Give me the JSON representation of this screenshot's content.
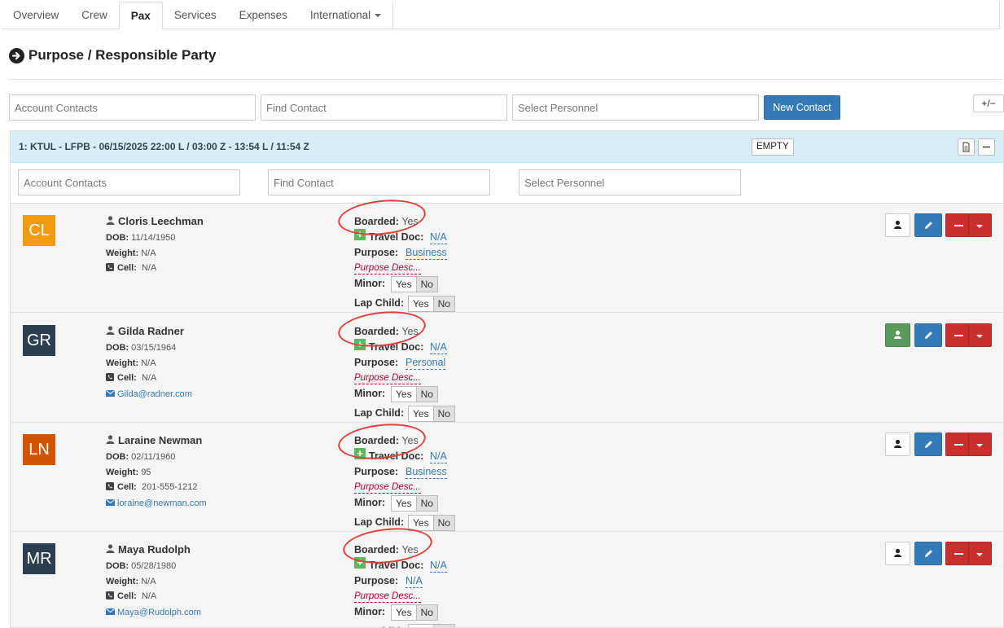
{
  "tabs": [
    {
      "label": "Overview"
    },
    {
      "label": "Crew"
    },
    {
      "label": "Pax"
    },
    {
      "label": "Services"
    },
    {
      "label": "Expenses"
    },
    {
      "label": "International"
    }
  ],
  "page_title": "Purpose / Responsible Party",
  "top_inputs": {
    "account_contacts_placeholder": "Account Contacts",
    "find_contact_placeholder": "Find Contact",
    "select_personnel_placeholder": "Select Personnel",
    "new_contact_label": "New Contact",
    "plus_minus_label": "+/−"
  },
  "leg": {
    "title": "1: KTUL - LFPB - 06/15/2025 22:00 L / 03:00 Z - 13:54 L / 11:54 Z",
    "status": "EMPTY",
    "account_contacts_placeholder": "Account Contacts",
    "find_contact_placeholder": "Find Contact",
    "select_personnel_placeholder": "Select Personnel"
  },
  "labels": {
    "dob": "DOB:",
    "weight": "Weight:",
    "cell": "Cell:",
    "boarded": "Boarded:",
    "travel_doc": "Travel Doc:",
    "purpose": "Purpose:",
    "purpose_desc": "Purpose Desc...",
    "minor": "Minor:",
    "lap_child": "Lap Child:",
    "yes": "Yes",
    "no": "No"
  },
  "passengers": [
    {
      "initials": "CL",
      "avatar_color": "#f39c12",
      "name": "Cloris Leechman",
      "dob": "11/14/1950",
      "weight": "N/A",
      "cell": "N/A",
      "email": "",
      "boarded": "Yes",
      "travel_doc": "N/A",
      "purpose": "Business",
      "profile_icon_green": false
    },
    {
      "initials": "GR",
      "avatar_color": "#2c3e50",
      "name": "Gilda Radner",
      "dob": "03/15/1964",
      "weight": "N/A",
      "cell": "N/A",
      "email": "Gilda@radner.com",
      "boarded": "Yes",
      "travel_doc": "N/A",
      "purpose": "Personal",
      "profile_icon_green": true
    },
    {
      "initials": "LN",
      "avatar_color": "#d35400",
      "name": "Laraine Newman",
      "dob": "02/11/1960",
      "weight": "95",
      "cell": "201-555-1212",
      "email": "loraine@newman.com",
      "boarded": "Yes",
      "travel_doc": "N/A",
      "purpose": "Business",
      "profile_icon_green": false
    },
    {
      "initials": "MR",
      "avatar_color": "#2c3e50",
      "name": "Maya Rudolph",
      "dob": "05/28/1980",
      "weight": "N/A",
      "cell": "N/A",
      "email": "Maya@Rudolph.com",
      "boarded": "Yes",
      "travel_doc": "N/A",
      "purpose": "N/A",
      "profile_icon_green": false
    }
  ]
}
